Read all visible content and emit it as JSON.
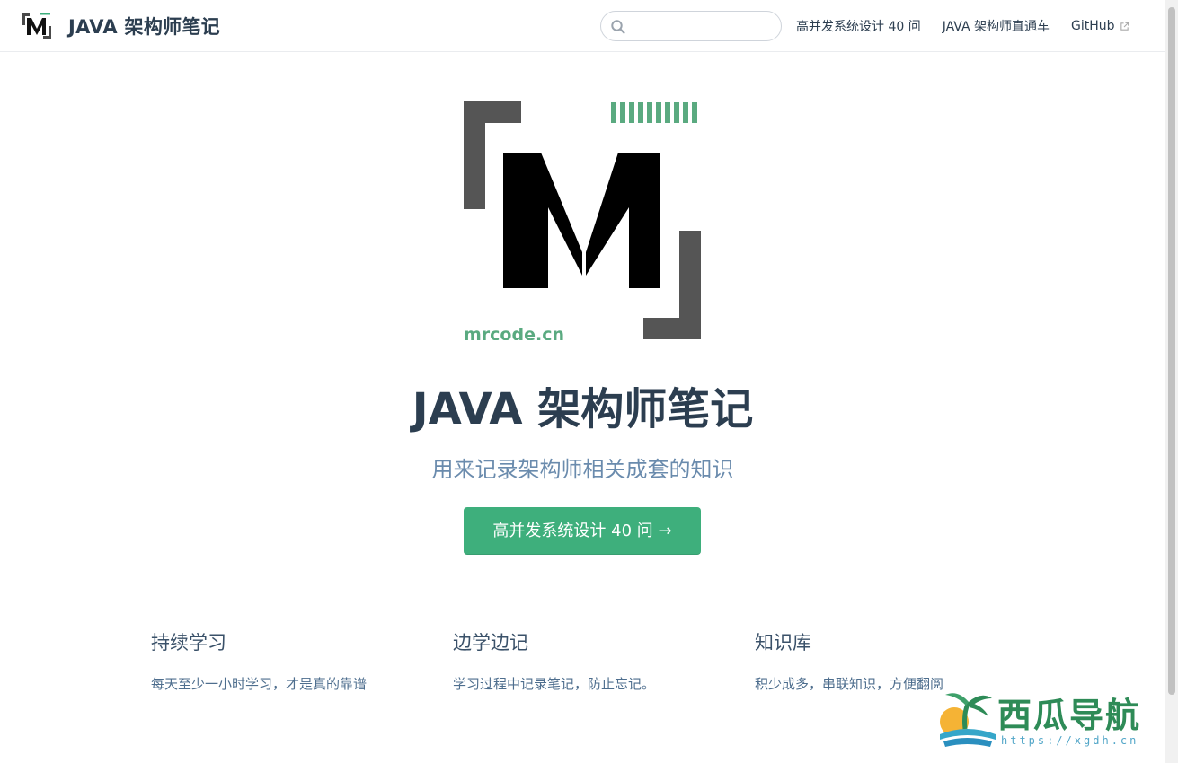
{
  "navbar": {
    "title": "JAVA 架构师笔记",
    "search": {
      "value": "",
      "placeholder": ""
    },
    "links": [
      {
        "label": "高并发系统设计 40 问"
      },
      {
        "label": "JAVA 架构师直通车"
      },
      {
        "label": "GitHub"
      }
    ]
  },
  "hero": {
    "logo_text": "mrcode.cn",
    "title": "JAVA 架构师笔记",
    "description": "用来记录架构师相关成套的知识",
    "action_label": "高并发系统设计 40 问 →"
  },
  "features": [
    {
      "title": "持续学习",
      "details": "每天至少一小时学习，才是真的靠谱"
    },
    {
      "title": "边学边记",
      "details": "学习过程中记录笔记，防止忘记。"
    },
    {
      "title": "知识库",
      "details": "积少成多，串联知识，方便翻阅"
    }
  ],
  "watermark": {
    "text": "西瓜导航",
    "url": "https://xgdh.cn"
  },
  "colors": {
    "accent": "#3eaf7c",
    "text": "#2c3e50",
    "description": "#6a8bad"
  }
}
